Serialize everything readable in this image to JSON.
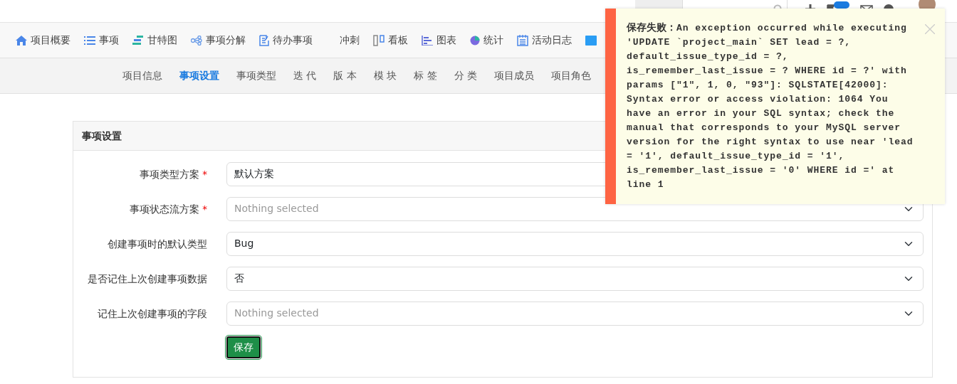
{
  "main_nav": [
    {
      "label": "项目概要"
    },
    {
      "label": "事项"
    },
    {
      "label": "甘特图"
    },
    {
      "label": "事项分解"
    },
    {
      "label": "待办事项"
    },
    {
      "label": "冲刺"
    },
    {
      "label": "看板"
    },
    {
      "label": "图表"
    },
    {
      "label": "统计"
    },
    {
      "label": "活动日志"
    }
  ],
  "sub_nav": [
    {
      "label": "项目信息",
      "selected": false
    },
    {
      "label": "事项设置",
      "selected": true
    },
    {
      "label": "事项类型",
      "selected": false
    },
    {
      "label": "迭 代",
      "selected": false
    },
    {
      "label": "版 本",
      "selected": false
    },
    {
      "label": "模 块",
      "selected": false
    },
    {
      "label": "标 签",
      "selected": false
    },
    {
      "label": "分 类",
      "selected": false
    },
    {
      "label": "项目成员",
      "selected": false
    },
    {
      "label": "项目角色",
      "selected": false
    }
  ],
  "card": {
    "title": "事项设置",
    "fields": [
      {
        "label": "事项类型方案",
        "required_mark": "*",
        "value": "默认方案"
      },
      {
        "label": "事项状态流方案",
        "required_mark": "*",
        "placeholder": "Nothing selected"
      },
      {
        "label": "创建事项时的默认类型",
        "value": "Bug"
      },
      {
        "label": "是否记住上次创建事项数据",
        "value": "否"
      },
      {
        "label": "记住上次创建事项的字段",
        "placeholder": "Nothing selected"
      }
    ],
    "save_button": "保存"
  },
  "toast": {
    "title": "保存失败：",
    "message": "An exception occurred while executing 'UPDATE `project_main` SET lead = ?, default_issue_type_id = ?, is_remember_last_issue = ? WHERE id = ?' with params [\"1\", 1, 0, \"93\"]: SQLSTATE[42000]: Syntax error or access violation: 1064 You have an error in your SQL syntax; check the manual that corresponds to your MySQL server version for the right syntax to use near 'lead = '1', default_issue_type_id = '1', is_remember_last_issue = '0' WHERE id =' at line 1"
  }
}
